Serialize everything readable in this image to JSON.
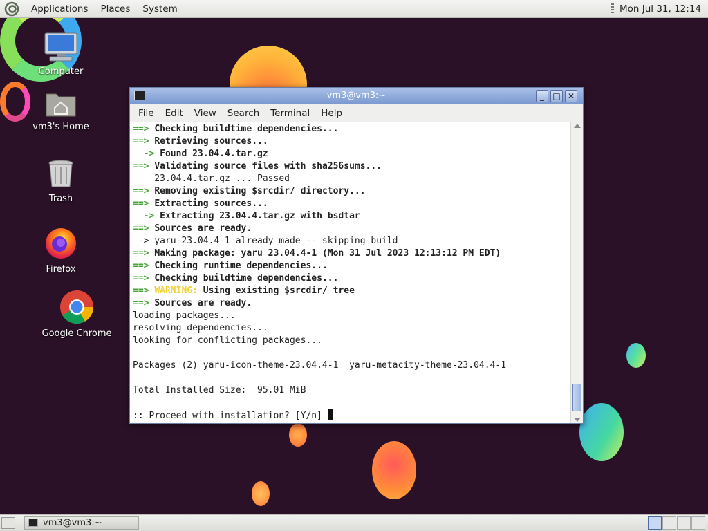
{
  "top_panel": {
    "menus": [
      "Applications",
      "Places",
      "System"
    ],
    "clock": "Mon Jul 31, 12:14"
  },
  "desktop_icons": [
    "Computer",
    "vm3's Home",
    "Trash",
    "Firefox",
    "Google Chrome"
  ],
  "terminal": {
    "title": "vm3@vm3:~",
    "menus": [
      "File",
      "Edit",
      "View",
      "Search",
      "Terminal",
      "Help"
    ],
    "lines": [
      {
        "arrow": "==>",
        "text": "Checking buildtime dependencies...",
        "bold": true
      },
      {
        "arrow": "==>",
        "text": "Retrieving sources...",
        "bold": true
      },
      {
        "arrow": "  ->",
        "text": "Found 23.04.4.tar.gz",
        "bold": true
      },
      {
        "arrow": "==>",
        "text": "Validating source files with sha256sums...",
        "bold": true
      },
      {
        "arrow": "",
        "text": "    23.04.4.tar.gz ... Passed",
        "bold": false
      },
      {
        "arrow": "==>",
        "text": "Removing existing $srcdir/ directory...",
        "bold": true
      },
      {
        "arrow": "==>",
        "text": "Extracting sources...",
        "bold": true
      },
      {
        "arrow": "  ->",
        "text": "Extracting 23.04.4.tar.gz with bsdtar",
        "bold": true
      },
      {
        "arrow": "==>",
        "text": "Sources are ready.",
        "bold": true
      },
      {
        "arrow": "",
        "text": " -> yaru-23.04.4-1 already made -- skipping build",
        "bold": false
      },
      {
        "arrow": "==>",
        "text": "Making package: yaru 23.04.4-1 (Mon 31 Jul 2023 12:13:12 PM EDT)",
        "bold": true
      },
      {
        "arrow": "==>",
        "text": "Checking runtime dependencies...",
        "bold": true
      },
      {
        "arrow": "==>",
        "text": "Checking buildtime dependencies...",
        "bold": true
      },
      {
        "arrow": "==>",
        "warning": "WARNING:",
        "text": "Using existing $srcdir/ tree",
        "bold": true
      },
      {
        "arrow": "==>",
        "text": "Sources are ready.",
        "bold": true
      },
      {
        "arrow": "",
        "text": "loading packages...",
        "bold": false
      },
      {
        "arrow": "",
        "text": "resolving dependencies...",
        "bold": false
      },
      {
        "arrow": "",
        "text": "looking for conflicting packages...",
        "bold": false
      },
      {
        "arrow": "",
        "text": "",
        "bold": false
      },
      {
        "arrow": "",
        "text": "Packages (2) yaru-icon-theme-23.04.4-1  yaru-metacity-theme-23.04.4-1",
        "bold": false
      },
      {
        "arrow": "",
        "text": "",
        "bold": false
      },
      {
        "arrow": "",
        "text": "Total Installed Size:  95.01 MiB",
        "bold": false
      },
      {
        "arrow": "",
        "text": "",
        "bold": false
      }
    ],
    "prompt": ":: Proceed with installation? [Y/n] "
  },
  "taskbar": {
    "task_label": "vm3@vm3:~"
  }
}
